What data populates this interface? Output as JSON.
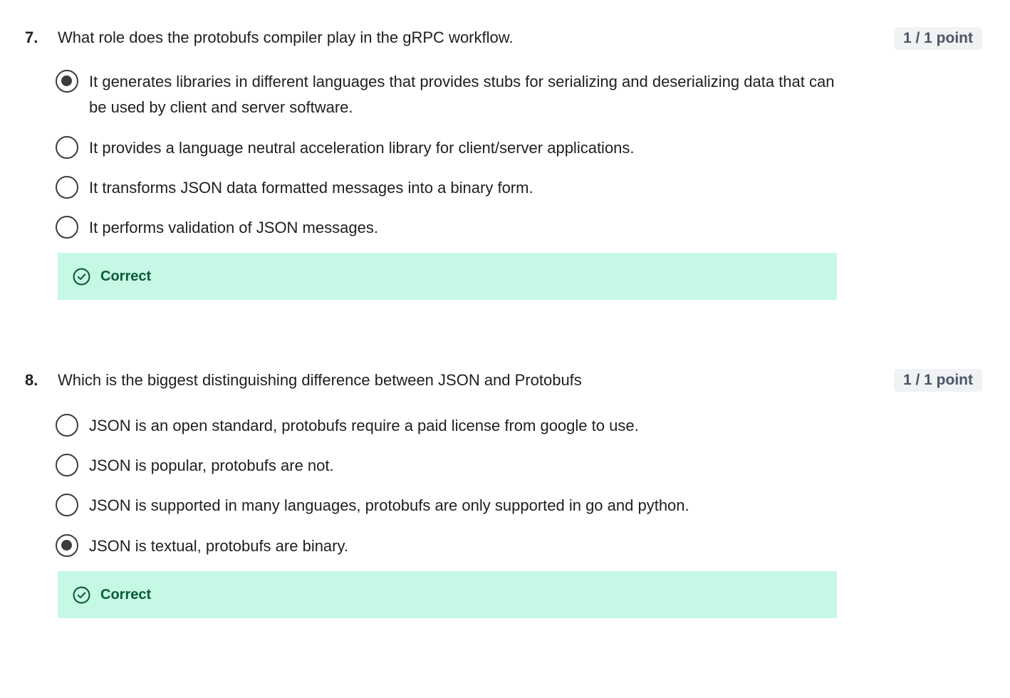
{
  "questions": [
    {
      "number": "7.",
      "text": "What role does the protobufs compiler play in the gRPC workflow.",
      "points": "1 / 1 point",
      "options": [
        {
          "text": "It generates libraries in different languages that provides stubs for serializing and deserializing data that can be used by client and server software.",
          "selected": true
        },
        {
          "text": "It provides a language neutral acceleration library for client/server applications.",
          "selected": false
        },
        {
          "text": "It transforms JSON data formatted messages into a binary form.",
          "selected": false
        },
        {
          "text": "It performs validation of JSON messages.",
          "selected": false
        }
      ],
      "feedback": {
        "icon": "check-circle-icon",
        "label": "Correct"
      }
    },
    {
      "number": "8.",
      "text": "Which is the biggest distinguishing difference between JSON and Protobufs",
      "points": "1 / 1 point",
      "options": [
        {
          "text": "JSON is an open standard, protobufs require a paid license from google to use.",
          "selected": false
        },
        {
          "text": "JSON is popular, protobufs are not.",
          "selected": false
        },
        {
          "text": "JSON is supported in many languages, protobufs are only supported in go and python.",
          "selected": false
        },
        {
          "text": "JSON is textual, protobufs are binary.",
          "selected": true
        }
      ],
      "feedback": {
        "icon": "check-circle-icon",
        "label": "Correct"
      }
    }
  ],
  "colors": {
    "feedback_bg": "#c5f8e5",
    "feedback_text": "#0b5a3a",
    "points_bg": "#f0f2f4",
    "points_text": "#4a5566"
  }
}
